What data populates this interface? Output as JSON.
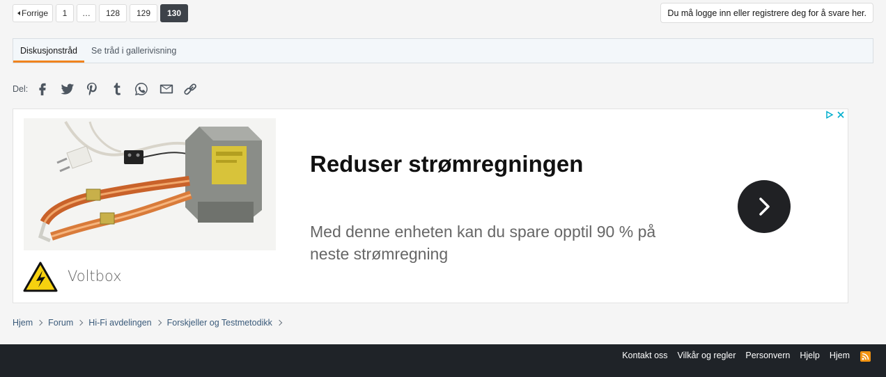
{
  "pagination": {
    "prev_label": "Forrige",
    "pages": [
      "1",
      "…",
      "128",
      "129",
      "130"
    ],
    "current": "130"
  },
  "reply_note": "Du må logge inn eller registrere deg for å svare her.",
  "tabs": [
    {
      "label": "Diskusjonstråd",
      "active": true
    },
    {
      "label": "Se tråd i gallerivisning",
      "active": false
    }
  ],
  "share": {
    "label": "Del:",
    "icons": [
      "facebook-icon",
      "twitter-icon",
      "pinterest-icon",
      "tumblr-icon",
      "whatsapp-icon",
      "email-icon",
      "link-icon"
    ]
  },
  "ad": {
    "headline": "Reduser strømregningen",
    "description": "Med denne enheten kan du spare opptil 90 % på neste strømregning",
    "advertiser": "Voltbox"
  },
  "breadcrumb": [
    "Hjem",
    "Forum",
    "Hi-Fi avdelingen",
    "Forskjeller og Testmetodikk"
  ],
  "footer": {
    "links": [
      "Kontakt oss",
      "Vilkår og regler",
      "Personvern",
      "Hjelp",
      "Hjem"
    ]
  },
  "colors": {
    "accent": "#f0831e",
    "current_page_bg": "#3d4249",
    "footer_bg": "#1f2328",
    "link": "#3a5a7a",
    "rss": "#f29311"
  }
}
